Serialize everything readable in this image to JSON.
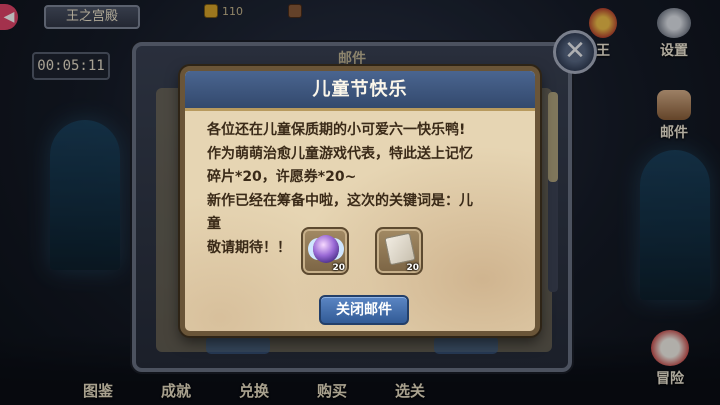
{
  "location": "王之宫殿",
  "currencies": [
    {
      "icon": "gold-bar-icon",
      "value": "110"
    },
    {
      "icon": "camera-icon",
      "value": ""
    }
  ],
  "timer": "00:05:11",
  "side_menu": {
    "king": "王",
    "settings": "设置",
    "mail": "邮件",
    "adventure": "冒险"
  },
  "bottom_nav": [
    "图鉴",
    "成就",
    "兑换",
    "购买",
    "选关"
  ],
  "mail_panel": {
    "title": "邮件",
    "close_icon": "close-x-icon"
  },
  "dialog": {
    "title": "儿童节快乐",
    "lines": [
      "各位还在儿童保质期的小可爱六一快乐鸭!",
      "作为萌萌治愈儿童游戏代表，特此送上记忆",
      "碎片*20，许愿券*20~",
      "新作已经在筹备中啦，这次的关键词是：儿",
      "童",
      "敬请期待！！"
    ],
    "items": [
      {
        "name": "记忆碎片",
        "icon": "memory-fragment-icon",
        "count": "20"
      },
      {
        "name": "许愿券",
        "icon": "wish-ticket-icon",
        "count": "20"
      }
    ],
    "close_button": "关闭邮件"
  },
  "colors": {
    "header_blue": "#3f5a85",
    "parchment": "#e6d5b3",
    "button_blue": "#4a74b0"
  }
}
